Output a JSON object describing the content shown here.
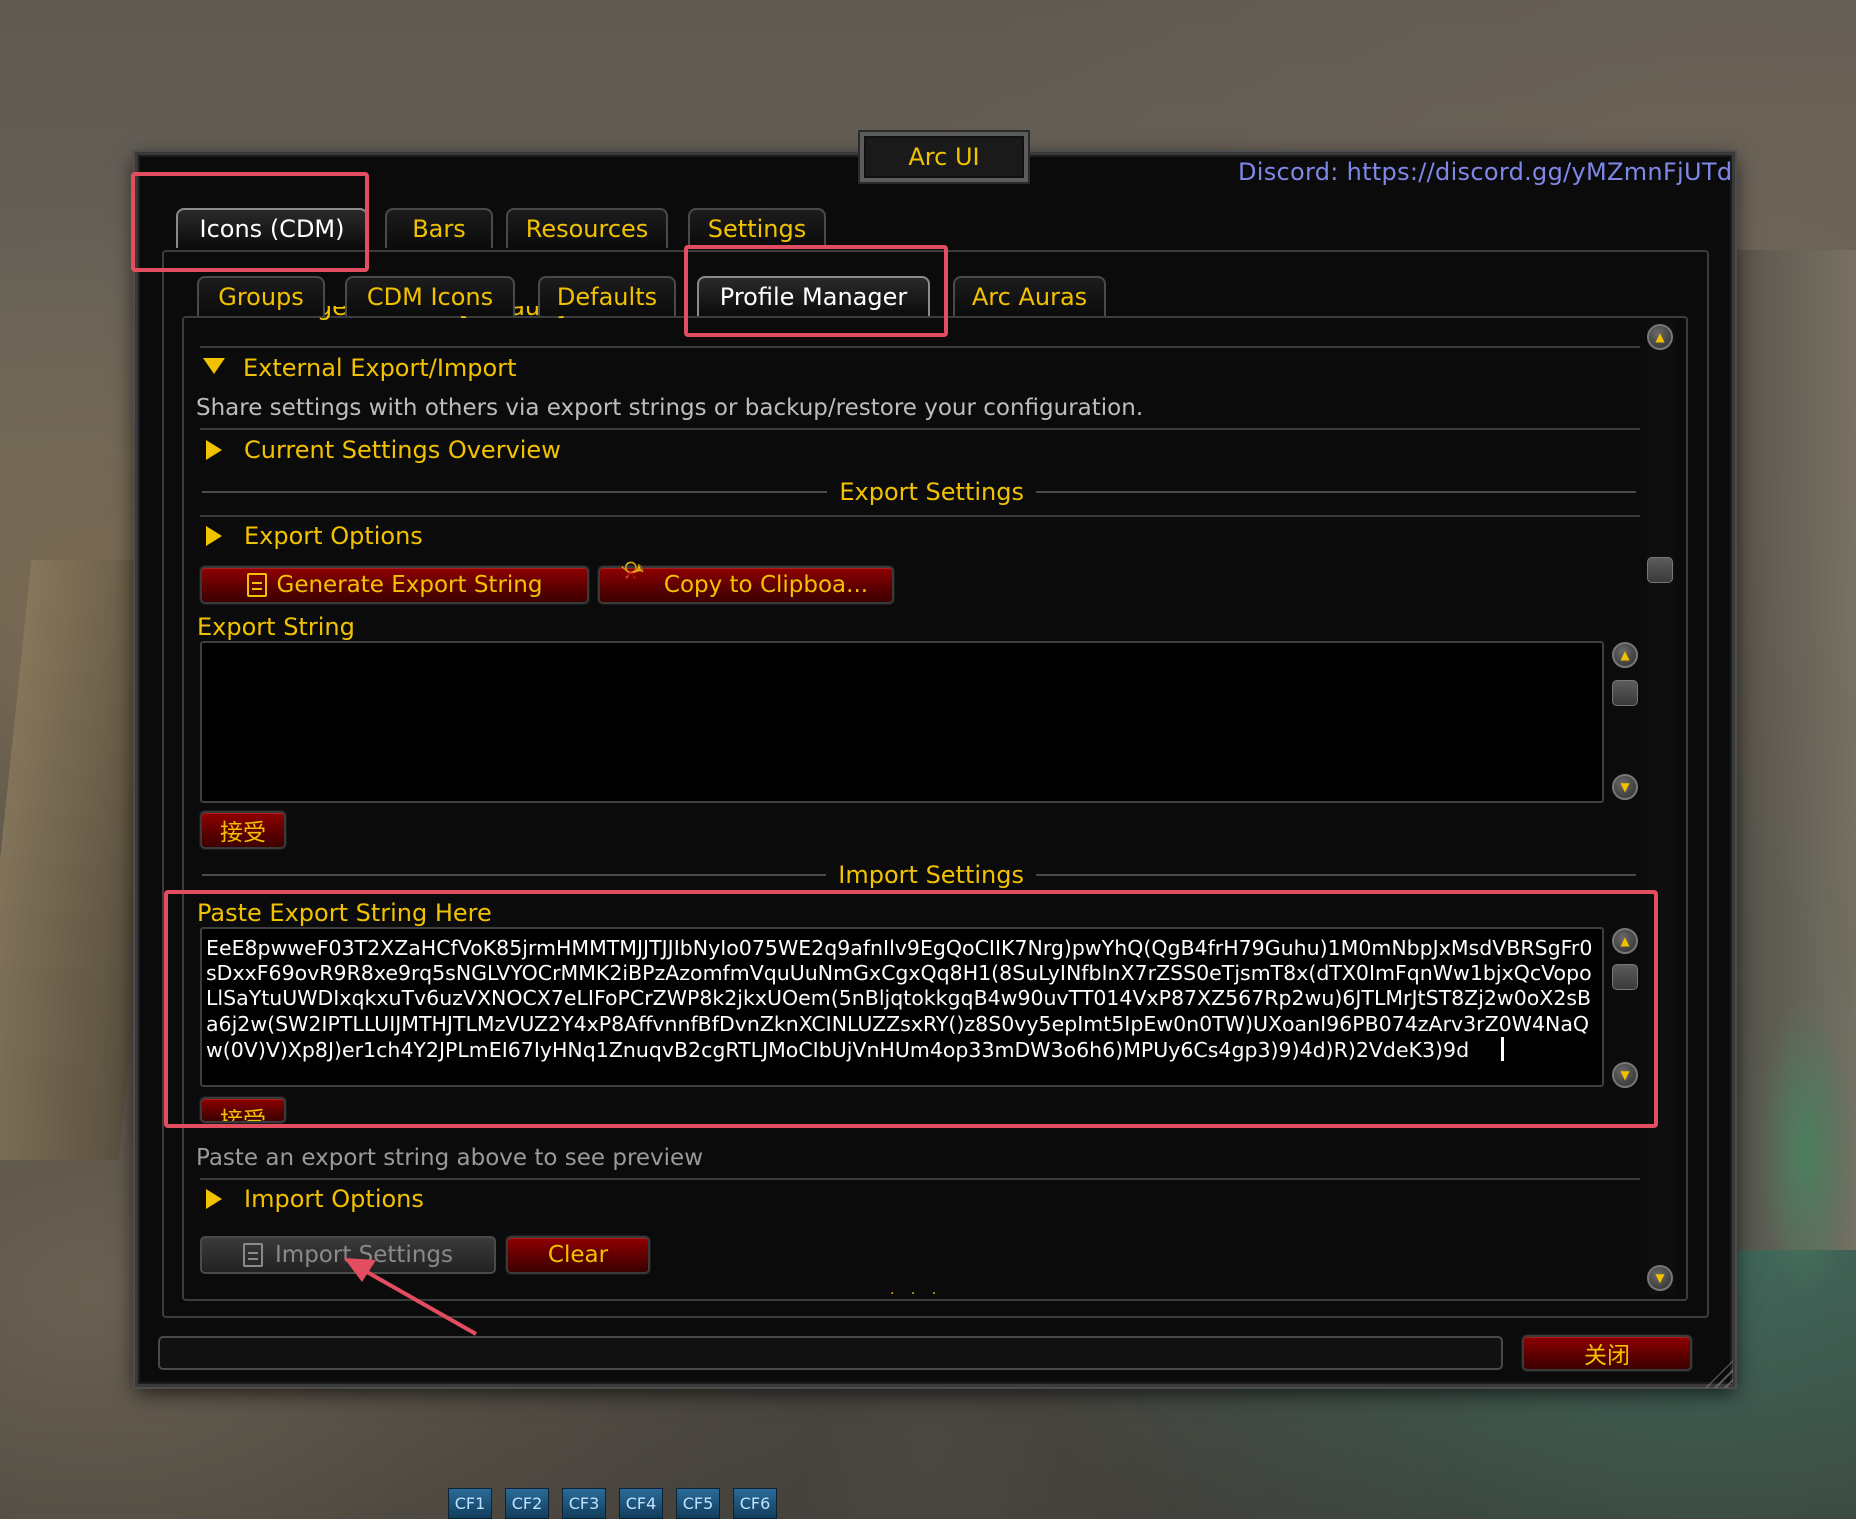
{
  "window": {
    "title": "Arc UI",
    "discord": "Discord: https://discord.gg/yMZmnFjUTd"
  },
  "top_tabs": [
    {
      "label": "Icons (CDM)",
      "active": true
    },
    {
      "label": "Bars",
      "active": false
    },
    {
      "label": "Resources",
      "active": false
    },
    {
      "label": "Settings",
      "active": false
    }
  ],
  "sub_tabs": [
    {
      "label": "Groups",
      "active": false
    },
    {
      "label": "CDM Icons",
      "active": false
    },
    {
      "label": "Defaults",
      "active": false
    },
    {
      "label": "Profile Manager",
      "active": true
    },
    {
      "label": "Arc Auras",
      "active": false
    }
  ],
  "content": {
    "cutoff_row": "Arc Manager Profiles [Default]",
    "external_header": "External Export/Import",
    "external_desc": "Share settings with others via export strings or backup/restore your configuration.",
    "current_overview": "Current Settings Overview",
    "export_section": "Export Settings",
    "export_options": "Export Options",
    "generate_btn": "Generate Export String",
    "copy_btn": "Copy to Clipboa...",
    "export_string_label": "Export String",
    "export_string_value": "",
    "accept_label": "接受",
    "import_section": "Import Settings",
    "paste_label": "Paste Export String Here",
    "paste_value": "EeE8pwweF03T2XZaHCfVoK85jrmHMMTMJJTJJIbNyIo075WE2q9afnIlv9EgQoCIIK7Nrg)pwYhQ(QgB4frH79Guhu)1M0mNbpJxMsdVBRSgFr0sDxxF69ovR9R8xe9rq5sNGLVYOCrMMK2iBPzAzomfmVquUuNmGxCgxQq8H1(8SuLyINfbInX7rZSS0eTjsmT8x(dTX0ImFqnWw1bjxQcVopoLlSaYtuUWDIxqkxuTv6uzVXNOCX7eLIFoPCrZWP8k2jkxUOem(5nBljqtokkgqB4w90uvTT014VxP87XZ567Rp2wu)6JTLMrJtST8Zj2w0oX2sBa6j2w(SW2IPTLLUIJMTHJTLMzVUZ2Y4xP8AffvnnfBfDvnZknXCINLUZZsxRY()z8S0vy5epImt5IpEw0n0TW)UXoanI96PB074zArv3rZ0W4NaQw(0V)V)Xp8J)er1ch4Y2JPLmEI67IyHNq1ZnuqvB2cgRTLJMoCIbUjVnHUm4op33mDW3o6h6)MPUy6Cs4gp3)9)4d)R)2VdeK3)9d",
    "accept_label_2": "接受",
    "preview_hint": "Paste an export string above to see preview",
    "import_options": "Import Options",
    "import_btn": "Import Settings",
    "clear_btn": "Clear",
    "dots": "· · ·"
  },
  "footer": {
    "close_btn": "关闭",
    "status_text": ""
  },
  "action_bar": [
    "CF1",
    "CF2",
    "CF3",
    "CF4",
    "CF5",
    "CF6"
  ],
  "colors": {
    "accent_gold": "#f2c200",
    "highlight_red": "#e24e5f",
    "discord_blue": "#7f88e8",
    "button_red": "#8f0000"
  }
}
